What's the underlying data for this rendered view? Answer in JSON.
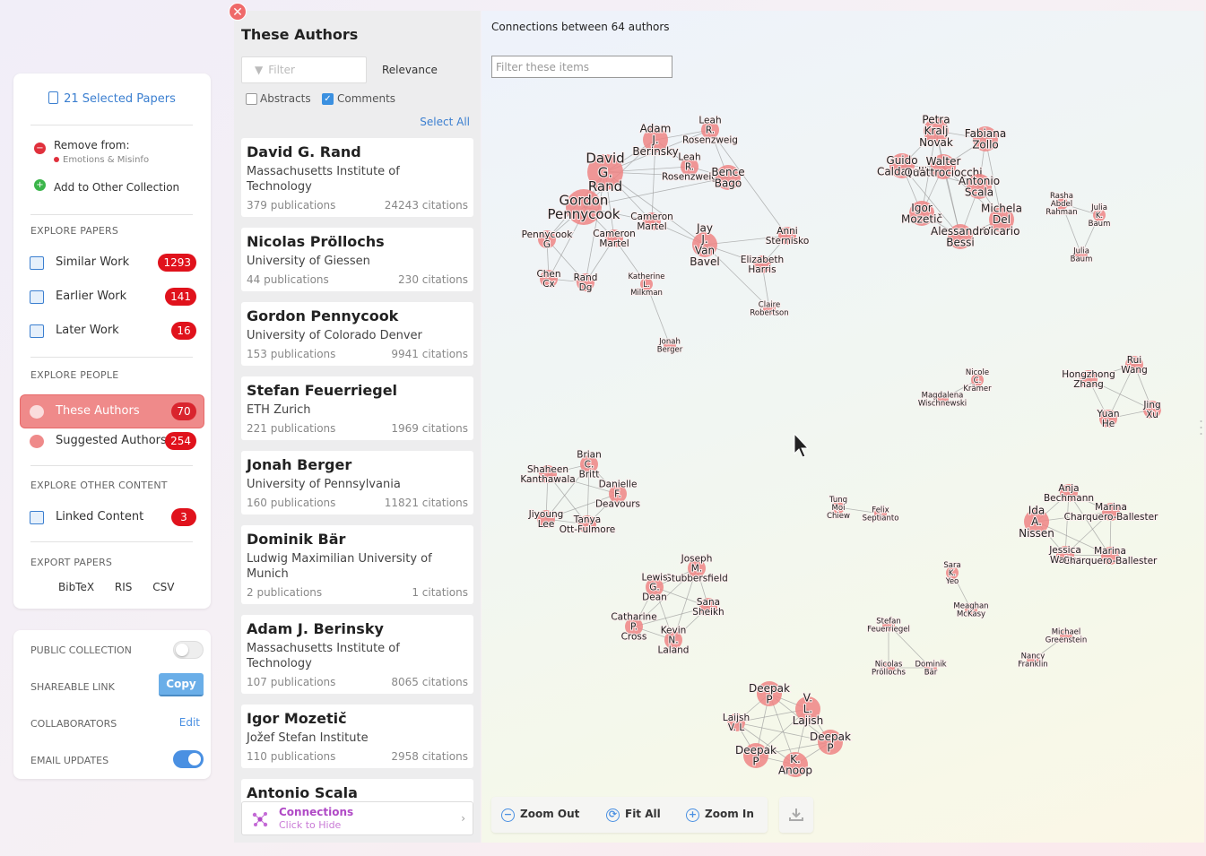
{
  "sidebar": {
    "selected_papers": "21 Selected Papers",
    "remove_label": "Remove from:",
    "remove_collection": "Emotions & Misinfo",
    "add_label": "Add to Other Collection",
    "explore_papers_heading": "EXPLORE PAPERS",
    "papers": [
      {
        "label": "Similar Work",
        "count": "1293"
      },
      {
        "label": "Earlier Work",
        "count": "141"
      },
      {
        "label": "Later Work",
        "count": "16"
      }
    ],
    "explore_people_heading": "EXPLORE PEOPLE",
    "people": [
      {
        "label": "These Authors",
        "count": "70"
      },
      {
        "label": "Suggested Authors",
        "count": "254"
      }
    ],
    "explore_other_heading": "EXPLORE OTHER CONTENT",
    "other": [
      {
        "label": "Linked Content",
        "count": "3"
      }
    ],
    "export_heading": "EXPORT PAPERS",
    "export_formats": [
      "BibTeX",
      "RIS",
      "CSV"
    ]
  },
  "settings": {
    "public_collection": "PUBLIC COLLECTION",
    "public_collection_on": false,
    "shareable_link": "SHAREABLE LINK",
    "copy_label": "Copy",
    "collaborators": "COLLABORATORS",
    "edit_label": "Edit",
    "email_updates": "EMAIL UPDATES",
    "email_updates_on": true
  },
  "list_panel": {
    "title": "These Authors",
    "filter_placeholder": "Filter",
    "sort": "Relevance",
    "abstracts_label": "Abstracts",
    "abstracts_checked": false,
    "comments_label": "Comments",
    "comments_checked": true,
    "select_all": "Select All",
    "authors": [
      {
        "name": "David G. Rand",
        "institution": "Massachusetts Institute of Technology",
        "publications": "379 publications",
        "citations": "24243 citations"
      },
      {
        "name": "Nicolas Pröllochs",
        "institution": "University of Giessen",
        "publications": "44 publications",
        "citations": "230 citations"
      },
      {
        "name": "Gordon Pennycook",
        "institution": "University of Colorado Denver",
        "publications": "153 publications",
        "citations": "9941 citations"
      },
      {
        "name": "Stefan Feuerriegel",
        "institution": "ETH Zurich",
        "publications": "221 publications",
        "citations": "1969 citations"
      },
      {
        "name": "Jonah Berger",
        "institution": "University of Pennsylvania",
        "publications": "160 publications",
        "citations": "11821 citations"
      },
      {
        "name": "Dominik Bär",
        "institution": "Ludwig Maximilian University of Munich",
        "publications": "2 publications",
        "citations": "1 citations"
      },
      {
        "name": "Adam J. Berinsky",
        "institution": "Massachusetts Institute of Technology",
        "publications": "107 publications",
        "citations": "8065 citations"
      },
      {
        "name": "Igor Mozetič",
        "institution": "Jožef Stefan Institute",
        "publications": "110 publications",
        "citations": "2958 citations"
      },
      {
        "name": "Antonio Scala",
        "institution": "",
        "publications": "",
        "citations": ""
      }
    ],
    "connections_title": "Connections",
    "connections_sub": "Click to Hide"
  },
  "graph": {
    "title": "Connections between 64 authors",
    "filter_placeholder": "Filter these items",
    "zoom_out": "Zoom Out",
    "fit_all": "Fit All",
    "zoom_in": "Zoom In",
    "node_color": "#ef8585",
    "edge_color": "#9a9a9a",
    "nodes": [
      {
        "id": "rand",
        "lines": [
          "David",
          "G.",
          "Rand"
        ],
        "size": 3
      },
      {
        "id": "berinsky",
        "lines": [
          "Adam",
          "J.",
          "Berinsky"
        ],
        "size": 2
      },
      {
        "id": "rosenzweig1",
        "lines": [
          "Leah",
          "R.",
          "Rosenzweig"
        ],
        "size": 1
      },
      {
        "id": "rosenzweig2",
        "lines": [
          "Leah",
          "R.",
          "Rosenzweig"
        ],
        "size": 1
      },
      {
        "id": "bago",
        "lines": [
          "Bence",
          "Bago"
        ],
        "size": 2
      },
      {
        "id": "pennycook",
        "lines": [
          "Gordon",
          "Pennycook"
        ],
        "size": 3
      },
      {
        "id": "martel1",
        "lines": [
          "Cameron",
          "Martel"
        ],
        "size": 1
      },
      {
        "id": "martel2",
        "lines": [
          "Cameron",
          "Martel"
        ],
        "size": 1
      },
      {
        "id": "pennycookg",
        "lines": [
          "Pennycook",
          "G"
        ],
        "size": 1
      },
      {
        "id": "vanbavel",
        "lines": [
          "Jay",
          "J.",
          "Van",
          "Bavel"
        ],
        "size": 2
      },
      {
        "id": "sternisko",
        "lines": [
          "Anni",
          "Sternisko"
        ],
        "size": 1
      },
      {
        "id": "harris",
        "lines": [
          "Elizabeth",
          "Harris"
        ],
        "size": 1
      },
      {
        "id": "chen",
        "lines": [
          "Chen",
          "Cx"
        ],
        "size": 1
      },
      {
        "id": "randdg",
        "lines": [
          "Rand",
          "Dg"
        ],
        "size": 1
      },
      {
        "id": "milkman",
        "lines": [
          "Katherine",
          "L.",
          "Milkman"
        ],
        "size": 0
      },
      {
        "id": "robertson",
        "lines": [
          "Claire",
          "Robertson"
        ],
        "size": 0
      },
      {
        "id": "berger",
        "lines": [
          "Jonah",
          "Berger"
        ],
        "size": 0
      },
      {
        "id": "novak",
        "lines": [
          "Petra",
          "Kralj",
          "Novak"
        ],
        "size": 2
      },
      {
        "id": "zollo",
        "lines": [
          "Fabiana",
          "Zollo"
        ],
        "size": 2
      },
      {
        "id": "caldarelli",
        "lines": [
          "Guido",
          "Caldarelli"
        ],
        "size": 2
      },
      {
        "id": "quattrociocchi",
        "lines": [
          "Walter",
          "Quattrociocchi"
        ],
        "size": 2
      },
      {
        "id": "scala",
        "lines": [
          "Antonio",
          "Scala"
        ],
        "size": 2
      },
      {
        "id": "mozetic",
        "lines": [
          "Igor",
          "Mozetič"
        ],
        "size": 2
      },
      {
        "id": "delvicario",
        "lines": [
          "Michela",
          "Del",
          "Vicario"
        ],
        "size": 2
      },
      {
        "id": "bessi",
        "lines": [
          "Alessandro",
          "Bessi"
        ],
        "size": 2
      },
      {
        "id": "rahman",
        "lines": [
          "Rasha",
          "Abdel",
          "Rahman"
        ],
        "size": 0
      },
      {
        "id": "baum1",
        "lines": [
          "Julia",
          "K.",
          "Baum"
        ],
        "size": 0
      },
      {
        "id": "baum2",
        "lines": [
          "Julia",
          "Baum"
        ],
        "size": 0
      },
      {
        "id": "kramer",
        "lines": [
          "Nicole",
          "C.",
          "Krämer"
        ],
        "size": 0
      },
      {
        "id": "wischnewski",
        "lines": [
          "Magdalena",
          "Wischnewski"
        ],
        "size": 0
      },
      {
        "id": "zhang",
        "lines": [
          "Hongzhong",
          "Zhang"
        ],
        "size": 1
      },
      {
        "id": "wang",
        "lines": [
          "Rui",
          "Wang"
        ],
        "size": 1
      },
      {
        "id": "xu",
        "lines": [
          "Jing",
          "Xu"
        ],
        "size": 1
      },
      {
        "id": "he",
        "lines": [
          "Yuan",
          "He"
        ],
        "size": 1
      },
      {
        "id": "kanthawala",
        "lines": [
          "Shaheen",
          "Kanthawala"
        ],
        "size": 1
      },
      {
        "id": "britt",
        "lines": [
          "Brian",
          "C.",
          "Britt"
        ],
        "size": 1
      },
      {
        "id": "deavours",
        "lines": [
          "Danielle",
          "F.",
          "Deavours"
        ],
        "size": 1
      },
      {
        "id": "jiyounglee",
        "lines": [
          "Jiyoung",
          "Lee"
        ],
        "size": 1
      },
      {
        "id": "ottfulmore",
        "lines": [
          "Tanya",
          "Ott-Fulmore"
        ],
        "size": 1
      },
      {
        "id": "chiew",
        "lines": [
          "Tung",
          "Moi",
          "Chiew"
        ],
        "size": 0
      },
      {
        "id": "septianto",
        "lines": [
          "Felix",
          "Septianto"
        ],
        "size": 0
      },
      {
        "id": "bechmann",
        "lines": [
          "Anja",
          "Bechmann"
        ],
        "size": 1
      },
      {
        "id": "charquero1",
        "lines": [
          "Marina",
          "Charquero-Ballester"
        ],
        "size": 1
      },
      {
        "id": "nissen",
        "lines": [
          "Ida",
          "A.",
          "Nissen"
        ],
        "size": 2
      },
      {
        "id": "walter",
        "lines": [
          "Jessica",
          "Walter"
        ],
        "size": 1
      },
      {
        "id": "charquero2",
        "lines": [
          "Marina",
          "Charquero-Ballester"
        ],
        "size": 1
      },
      {
        "id": "stubbersfield",
        "lines": [
          "Joseph",
          "M.",
          "Stubbersfield"
        ],
        "size": 1
      },
      {
        "id": "dean",
        "lines": [
          "Lewis",
          "G.",
          "Dean"
        ],
        "size": 1
      },
      {
        "id": "sheikh",
        "lines": [
          "Sana",
          "Sheikh"
        ],
        "size": 1
      },
      {
        "id": "cross",
        "lines": [
          "Catharine",
          "P.",
          "Cross"
        ],
        "size": 1
      },
      {
        "id": "laland",
        "lines": [
          "Kevin",
          "N.",
          "Laland"
        ],
        "size": 1
      },
      {
        "id": "yeo",
        "lines": [
          "Sara",
          "K.",
          "Yeo"
        ],
        "size": 0
      },
      {
        "id": "mckasy",
        "lines": [
          "Meaghan",
          "McKasy"
        ],
        "size": 0
      },
      {
        "id": "feuerriegel",
        "lines": [
          "Stefan",
          "Feuerriegel"
        ],
        "size": 0
      },
      {
        "id": "prollochs",
        "lines": [
          "Nicolas",
          "Pröllochs"
        ],
        "size": 0
      },
      {
        "id": "bar",
        "lines": [
          "Dominik",
          "Bär"
        ],
        "size": 0
      },
      {
        "id": "greenstein",
        "lines": [
          "Michael",
          "Greenstein"
        ],
        "size": 0
      },
      {
        "id": "franklin",
        "lines": [
          "Nancy",
          "Franklin"
        ],
        "size": 0
      },
      {
        "id": "deepak1",
        "lines": [
          "Deepak",
          "P"
        ],
        "size": 2
      },
      {
        "id": "lajish1",
        "lines": [
          "V.",
          "L.",
          "Lajish"
        ],
        "size": 2
      },
      {
        "id": "laijish2",
        "lines": [
          "Laijsh",
          "V. L"
        ],
        "size": 1
      },
      {
        "id": "deepak2",
        "lines": [
          "Deepak",
          "P"
        ],
        "size": 2
      },
      {
        "id": "deepak3",
        "lines": [
          "Deepak",
          "P"
        ],
        "size": 2
      },
      {
        "id": "anoop",
        "lines": [
          "K.",
          "Anoop"
        ],
        "size": 2
      }
    ]
  }
}
